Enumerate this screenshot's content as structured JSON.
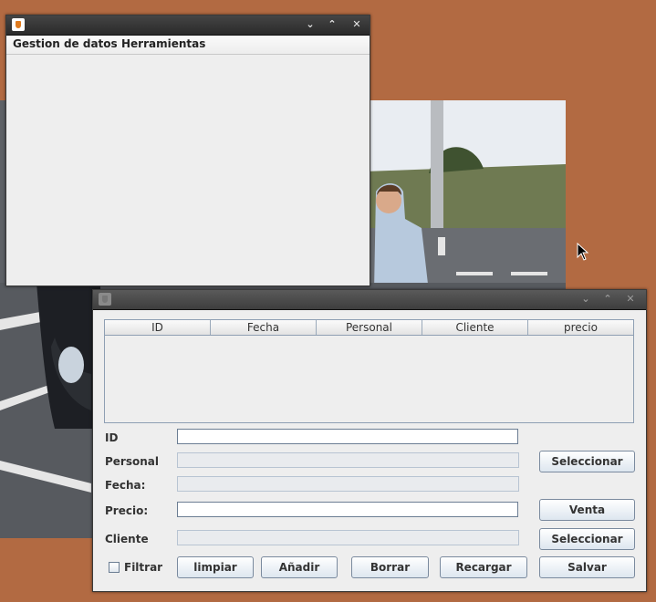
{
  "main_window": {
    "menu": [
      "Gestion de datos",
      "Herramientas"
    ],
    "controls": [
      "minimize-icon",
      "maximize-icon",
      "close-icon"
    ]
  },
  "ventas_window": {
    "table": {
      "columns": [
        "ID",
        "Fecha",
        "Personal",
        "Cliente",
        "precio"
      ],
      "rows": []
    },
    "form": {
      "id_label": "ID",
      "id_value": "",
      "personal_label": "Personal",
      "personal_value": "",
      "fecha_label": "Fecha:",
      "fecha_value": "",
      "precio_label": "Precio:",
      "precio_value": "",
      "cliente_label": "Cliente",
      "cliente_value": ""
    },
    "buttons": {
      "seleccionar_personal": "Seleccionar",
      "venta": "Venta",
      "seleccionar_cliente": "Seleccionar",
      "filtrar": "Filtrar",
      "limpiar": "limpiar",
      "anadir": "Añadir",
      "borrar": "Borrar",
      "recargar": "Recargar",
      "salvar": "Salvar"
    },
    "filtrar_checked": false
  },
  "colors": {
    "desktop": "#b26a42",
    "window_bg": "#eeeeee",
    "titlebar": "#2f2f2f"
  }
}
